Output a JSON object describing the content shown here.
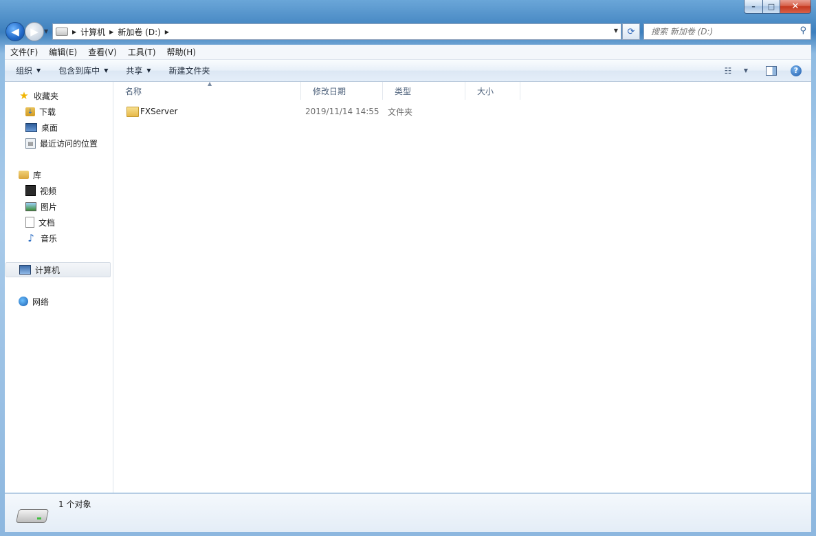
{
  "window": {
    "minimize_label": "–",
    "maximize_label": "□",
    "close_label": "✕"
  },
  "nav": {
    "back_glyph": "◀",
    "forward_glyph": "▶",
    "history_glyph": "▼",
    "breadcrumbs": [
      "计算机",
      "新加卷 (D:)"
    ],
    "search_placeholder": "搜索 新加卷 (D:)"
  },
  "menu": [
    "文件(F)",
    "编辑(E)",
    "查看(V)",
    "工具(T)",
    "帮助(H)"
  ],
  "commands": {
    "organize": "组织",
    "include_library": "包含到库中",
    "share": "共享",
    "new_folder": "新建文件夹"
  },
  "sidebar": {
    "favorites": "收藏夹",
    "fav_items": [
      "下载",
      "桌面",
      "最近访问的位置"
    ],
    "libraries": "库",
    "lib_items": [
      "视频",
      "图片",
      "文档",
      "音乐"
    ],
    "computer": "计算机",
    "network": "网络"
  },
  "columns": [
    "名称",
    "修改日期",
    "类型",
    "大小"
  ],
  "files": [
    {
      "name": "FXServer",
      "modified": "2019/11/14 14:55",
      "type": "文件夹",
      "size": ""
    }
  ],
  "details": {
    "count": "1 个对象"
  },
  "icons": [
    "star-icon",
    "downloads-icon",
    "desktop-icon",
    "recent-places-icon",
    "library-icon",
    "video-icon",
    "pictures-icon",
    "documents-icon",
    "music-icon",
    "computer-icon",
    "network-icon",
    "folder-icon",
    "drive-icon",
    "search-icon",
    "refresh-icon",
    "help-icon"
  ]
}
